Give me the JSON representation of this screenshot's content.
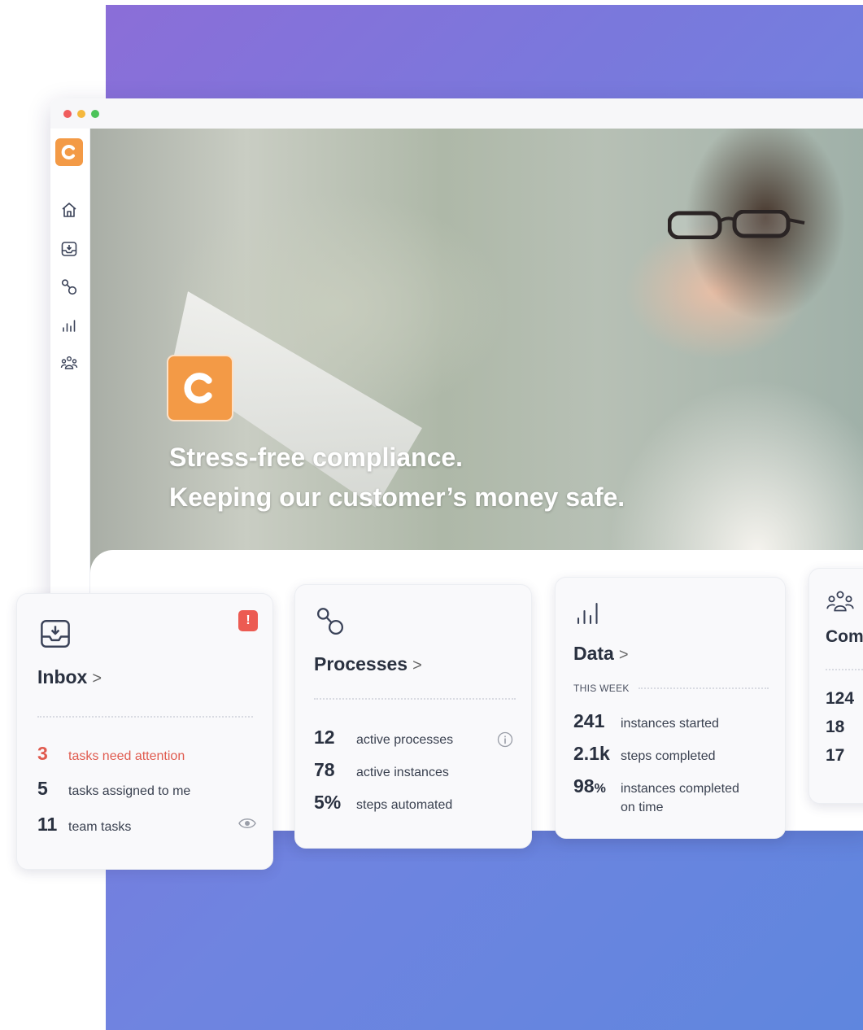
{
  "hero": {
    "line1": "Stress-free compliance.",
    "line2": "Keeping our customer’s money safe."
  },
  "brand": {
    "logo_letter": "C",
    "accent": "#f39a46",
    "alert_color": "#ec5b52"
  },
  "sidebar": {
    "icons": [
      "home-icon",
      "inbox-icon",
      "processes-icon",
      "data-icon",
      "community-icon"
    ]
  },
  "inbox": {
    "title": "Inbox",
    "chevron": ">",
    "badge": "!",
    "stats": [
      {
        "value": "3",
        "label": "tasks need attention"
      },
      {
        "value": "5",
        "label": "tasks assigned to me"
      },
      {
        "value": "11",
        "label": "team tasks"
      }
    ]
  },
  "processes": {
    "title": "Processes",
    "chevron": ">",
    "stats": [
      {
        "value": "12",
        "label": "active processes"
      },
      {
        "value": "78",
        "label": "active instances"
      },
      {
        "value": "5%",
        "label": "steps automated"
      }
    ]
  },
  "data": {
    "title": "Data",
    "chevron": ">",
    "period": "THIS WEEK",
    "stats": [
      {
        "value": "241",
        "label": "instances started"
      },
      {
        "value": "2.1k",
        "label": "steps completed"
      },
      {
        "value": "98",
        "unit": "%",
        "label": "instances completed",
        "label2": "on time"
      }
    ]
  },
  "community": {
    "title": "Com",
    "stats": [
      {
        "value": "124"
      },
      {
        "value": "18"
      },
      {
        "value": "17"
      }
    ]
  }
}
